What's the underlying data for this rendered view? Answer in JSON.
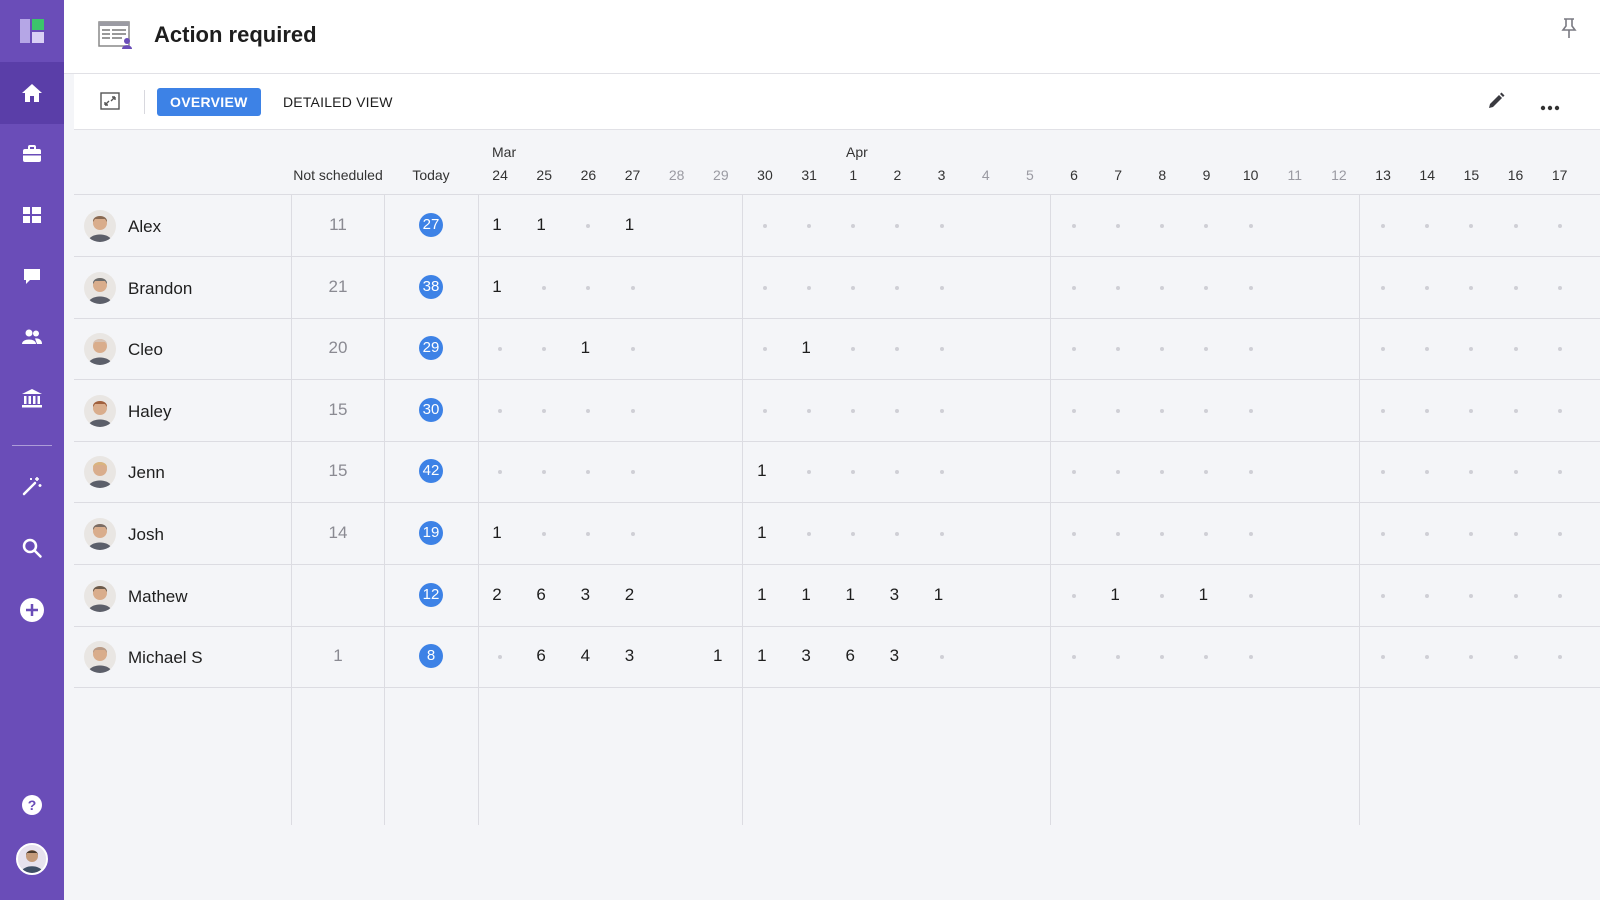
{
  "header": {
    "title": "Action required"
  },
  "toolbar": {
    "tabs": {
      "overview": "OVERVIEW",
      "detailed": "DETAILED VIEW"
    }
  },
  "colors": {
    "sidebar": "#6a4db8",
    "sidebar_active": "#5a3ea8",
    "accent": "#3d82e6"
  },
  "sidebar": {
    "items": [
      {
        "icon": "home-icon",
        "active": true
      },
      {
        "icon": "briefcase-icon"
      },
      {
        "icon": "dashboard-icon"
      },
      {
        "icon": "chat-icon"
      },
      {
        "icon": "people-icon"
      },
      {
        "icon": "bank-icon"
      },
      {
        "icon": "magic-wand-icon"
      },
      {
        "icon": "search-icon"
      },
      {
        "icon": "add-icon"
      },
      {
        "icon": "help-icon"
      }
    ]
  },
  "table": {
    "headers": {
      "not_scheduled": "Not scheduled",
      "today": "Today"
    },
    "months": [
      "Mar",
      "Apr"
    ],
    "days": [
      {
        "label": "24"
      },
      {
        "label": "25"
      },
      {
        "label": "26"
      },
      {
        "label": "27"
      },
      {
        "label": "28",
        "weekend": true
      },
      {
        "label": "29",
        "weekend": true
      },
      {
        "label": "30"
      },
      {
        "label": "31"
      },
      {
        "label": "1"
      },
      {
        "label": "2"
      },
      {
        "label": "3"
      },
      {
        "label": "4",
        "weekend": true
      },
      {
        "label": "5",
        "weekend": true
      },
      {
        "label": "6"
      },
      {
        "label": "7"
      },
      {
        "label": "8"
      },
      {
        "label": "9"
      },
      {
        "label": "10"
      },
      {
        "label": "11",
        "weekend": true
      },
      {
        "label": "12",
        "weekend": true
      },
      {
        "label": "13"
      },
      {
        "label": "14"
      },
      {
        "label": "15"
      },
      {
        "label": "16"
      },
      {
        "label": "17"
      }
    ],
    "rows": [
      {
        "name": "Alex",
        "not_scheduled": "11",
        "today": "27",
        "cells": [
          "1",
          "1",
          ".",
          "1",
          "",
          "",
          ".",
          ".",
          ".",
          ".",
          ".",
          "",
          "",
          ".",
          ".",
          ".",
          ".",
          ".",
          "",
          "",
          ".",
          ".",
          ".",
          ".",
          "."
        ]
      },
      {
        "name": "Brandon",
        "not_scheduled": "21",
        "today": "38",
        "cells": [
          "1",
          ".",
          ".",
          ".",
          "",
          "",
          ".",
          ".",
          ".",
          ".",
          ".",
          "",
          "",
          ".",
          ".",
          ".",
          ".",
          ".",
          "",
          "",
          ".",
          ".",
          ".",
          ".",
          "."
        ]
      },
      {
        "name": "Cleo",
        "not_scheduled": "20",
        "today": "29",
        "cells": [
          ".",
          ".",
          "1",
          ".",
          "",
          "",
          ".",
          "1",
          ".",
          ".",
          ".",
          "",
          "",
          ".",
          ".",
          ".",
          ".",
          ".",
          "",
          "",
          ".",
          ".",
          ".",
          ".",
          "."
        ]
      },
      {
        "name": "Haley",
        "not_scheduled": "15",
        "today": "30",
        "cells": [
          ".",
          ".",
          ".",
          ".",
          "",
          "",
          ".",
          ".",
          ".",
          ".",
          ".",
          "",
          "",
          ".",
          ".",
          ".",
          ".",
          ".",
          "",
          "",
          ".",
          ".",
          ".",
          ".",
          "."
        ]
      },
      {
        "name": "Jenn",
        "not_scheduled": "15",
        "today": "42",
        "cells": [
          ".",
          ".",
          ".",
          ".",
          "",
          "",
          "1",
          ".",
          ".",
          ".",
          ".",
          "",
          "",
          ".",
          ".",
          ".",
          ".",
          ".",
          "",
          "",
          ".",
          ".",
          ".",
          ".",
          "."
        ]
      },
      {
        "name": "Josh",
        "not_scheduled": "14",
        "today": "19",
        "cells": [
          "1",
          ".",
          ".",
          ".",
          "",
          "",
          "1",
          ".",
          ".",
          ".",
          ".",
          "",
          "",
          ".",
          ".",
          ".",
          ".",
          ".",
          "",
          "",
          ".",
          ".",
          ".",
          ".",
          "."
        ]
      },
      {
        "name": "Mathew",
        "not_scheduled": "",
        "today": "12",
        "cells": [
          "2",
          "6",
          "3",
          "2",
          "",
          "",
          "1",
          "1",
          "1",
          "3",
          "1",
          "",
          "",
          ".",
          "1",
          ".",
          "1",
          ".",
          "",
          "",
          ".",
          ".",
          ".",
          ".",
          "."
        ]
      },
      {
        "name": "Michael S",
        "not_scheduled": "1",
        "today": "8",
        "cells": [
          ".",
          "6",
          "4",
          "3",
          "",
          "1",
          "1",
          "3",
          "6",
          "3",
          ".",
          "",
          "",
          ".",
          ".",
          ".",
          ".",
          ".",
          "",
          "",
          ".",
          ".",
          ".",
          ".",
          "."
        ]
      }
    ]
  }
}
